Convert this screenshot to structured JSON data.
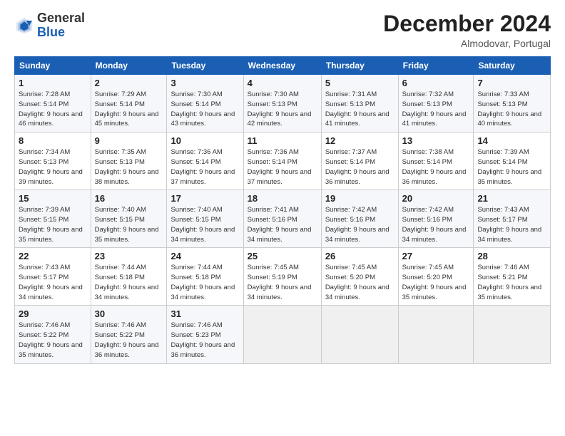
{
  "header": {
    "logo_general": "General",
    "logo_blue": "Blue",
    "month_title": "December 2024",
    "location": "Almodovar, Portugal"
  },
  "days_of_week": [
    "Sunday",
    "Monday",
    "Tuesday",
    "Wednesday",
    "Thursday",
    "Friday",
    "Saturday"
  ],
  "weeks": [
    [
      {
        "num": "1",
        "sunrise": "Sunrise: 7:28 AM",
        "sunset": "Sunset: 5:14 PM",
        "daylight": "Daylight: 9 hours and 46 minutes."
      },
      {
        "num": "2",
        "sunrise": "Sunrise: 7:29 AM",
        "sunset": "Sunset: 5:14 PM",
        "daylight": "Daylight: 9 hours and 45 minutes."
      },
      {
        "num": "3",
        "sunrise": "Sunrise: 7:30 AM",
        "sunset": "Sunset: 5:14 PM",
        "daylight": "Daylight: 9 hours and 43 minutes."
      },
      {
        "num": "4",
        "sunrise": "Sunrise: 7:30 AM",
        "sunset": "Sunset: 5:13 PM",
        "daylight": "Daylight: 9 hours and 42 minutes."
      },
      {
        "num": "5",
        "sunrise": "Sunrise: 7:31 AM",
        "sunset": "Sunset: 5:13 PM",
        "daylight": "Daylight: 9 hours and 41 minutes."
      },
      {
        "num": "6",
        "sunrise": "Sunrise: 7:32 AM",
        "sunset": "Sunset: 5:13 PM",
        "daylight": "Daylight: 9 hours and 41 minutes."
      },
      {
        "num": "7",
        "sunrise": "Sunrise: 7:33 AM",
        "sunset": "Sunset: 5:13 PM",
        "daylight": "Daylight: 9 hours and 40 minutes."
      }
    ],
    [
      {
        "num": "8",
        "sunrise": "Sunrise: 7:34 AM",
        "sunset": "Sunset: 5:13 PM",
        "daylight": "Daylight: 9 hours and 39 minutes."
      },
      {
        "num": "9",
        "sunrise": "Sunrise: 7:35 AM",
        "sunset": "Sunset: 5:13 PM",
        "daylight": "Daylight: 9 hours and 38 minutes."
      },
      {
        "num": "10",
        "sunrise": "Sunrise: 7:36 AM",
        "sunset": "Sunset: 5:14 PM",
        "daylight": "Daylight: 9 hours and 37 minutes."
      },
      {
        "num": "11",
        "sunrise": "Sunrise: 7:36 AM",
        "sunset": "Sunset: 5:14 PM",
        "daylight": "Daylight: 9 hours and 37 minutes."
      },
      {
        "num": "12",
        "sunrise": "Sunrise: 7:37 AM",
        "sunset": "Sunset: 5:14 PM",
        "daylight": "Daylight: 9 hours and 36 minutes."
      },
      {
        "num": "13",
        "sunrise": "Sunrise: 7:38 AM",
        "sunset": "Sunset: 5:14 PM",
        "daylight": "Daylight: 9 hours and 36 minutes."
      },
      {
        "num": "14",
        "sunrise": "Sunrise: 7:39 AM",
        "sunset": "Sunset: 5:14 PM",
        "daylight": "Daylight: 9 hours and 35 minutes."
      }
    ],
    [
      {
        "num": "15",
        "sunrise": "Sunrise: 7:39 AM",
        "sunset": "Sunset: 5:15 PM",
        "daylight": "Daylight: 9 hours and 35 minutes."
      },
      {
        "num": "16",
        "sunrise": "Sunrise: 7:40 AM",
        "sunset": "Sunset: 5:15 PM",
        "daylight": "Daylight: 9 hours and 35 minutes."
      },
      {
        "num": "17",
        "sunrise": "Sunrise: 7:40 AM",
        "sunset": "Sunset: 5:15 PM",
        "daylight": "Daylight: 9 hours and 34 minutes."
      },
      {
        "num": "18",
        "sunrise": "Sunrise: 7:41 AM",
        "sunset": "Sunset: 5:16 PM",
        "daylight": "Daylight: 9 hours and 34 minutes."
      },
      {
        "num": "19",
        "sunrise": "Sunrise: 7:42 AM",
        "sunset": "Sunset: 5:16 PM",
        "daylight": "Daylight: 9 hours and 34 minutes."
      },
      {
        "num": "20",
        "sunrise": "Sunrise: 7:42 AM",
        "sunset": "Sunset: 5:16 PM",
        "daylight": "Daylight: 9 hours and 34 minutes."
      },
      {
        "num": "21",
        "sunrise": "Sunrise: 7:43 AM",
        "sunset": "Sunset: 5:17 PM",
        "daylight": "Daylight: 9 hours and 34 minutes."
      }
    ],
    [
      {
        "num": "22",
        "sunrise": "Sunrise: 7:43 AM",
        "sunset": "Sunset: 5:17 PM",
        "daylight": "Daylight: 9 hours and 34 minutes."
      },
      {
        "num": "23",
        "sunrise": "Sunrise: 7:44 AM",
        "sunset": "Sunset: 5:18 PM",
        "daylight": "Daylight: 9 hours and 34 minutes."
      },
      {
        "num": "24",
        "sunrise": "Sunrise: 7:44 AM",
        "sunset": "Sunset: 5:18 PM",
        "daylight": "Daylight: 9 hours and 34 minutes."
      },
      {
        "num": "25",
        "sunrise": "Sunrise: 7:45 AM",
        "sunset": "Sunset: 5:19 PM",
        "daylight": "Daylight: 9 hours and 34 minutes."
      },
      {
        "num": "26",
        "sunrise": "Sunrise: 7:45 AM",
        "sunset": "Sunset: 5:20 PM",
        "daylight": "Daylight: 9 hours and 34 minutes."
      },
      {
        "num": "27",
        "sunrise": "Sunrise: 7:45 AM",
        "sunset": "Sunset: 5:20 PM",
        "daylight": "Daylight: 9 hours and 35 minutes."
      },
      {
        "num": "28",
        "sunrise": "Sunrise: 7:46 AM",
        "sunset": "Sunset: 5:21 PM",
        "daylight": "Daylight: 9 hours and 35 minutes."
      }
    ],
    [
      {
        "num": "29",
        "sunrise": "Sunrise: 7:46 AM",
        "sunset": "Sunset: 5:22 PM",
        "daylight": "Daylight: 9 hours and 35 minutes."
      },
      {
        "num": "30",
        "sunrise": "Sunrise: 7:46 AM",
        "sunset": "Sunset: 5:22 PM",
        "daylight": "Daylight: 9 hours and 36 minutes."
      },
      {
        "num": "31",
        "sunrise": "Sunrise: 7:46 AM",
        "sunset": "Sunset: 5:23 PM",
        "daylight": "Daylight: 9 hours and 36 minutes."
      },
      null,
      null,
      null,
      null
    ]
  ]
}
